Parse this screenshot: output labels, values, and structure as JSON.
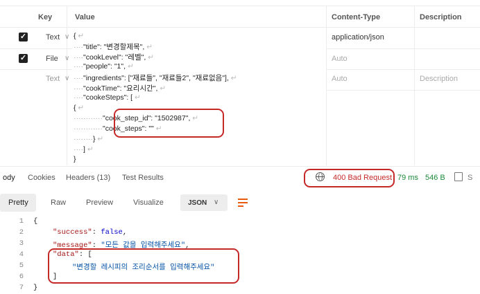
{
  "params_table": {
    "headers": {
      "key": "Key",
      "value": "Value",
      "content_type": "Content-Type",
      "description": "Description"
    },
    "rows": [
      {
        "type": "Text",
        "content_type": "application/json",
        "description": ""
      },
      {
        "type": "File",
        "content_type": "Auto",
        "description": ""
      },
      {
        "type": "Text",
        "content_type": "Auto",
        "description": "Description"
      }
    ],
    "value_lines": [
      "{",
      "\"title\": \"변경할제목\",",
      "\"cookLevel\": \"레벨\",",
      "\"people\": \"1\",",
      "\"ingredients\": [\"재료들\", \"재료들2\", \"재료없음\"],",
      "\"cookTime\": \"요리시간\",",
      "\"cookeSteps\": [",
      "{",
      "\"cook_step_id\": \"1502987\",",
      "\"cook_steps\": \"\"",
      "}",
      "]",
      "}"
    ]
  },
  "response_tabs": {
    "body": "ody",
    "cookies": "Cookies",
    "headers": "Headers (13)",
    "test_results": "Test Results"
  },
  "status": {
    "code": "400 Bad Request",
    "time": "79 ms",
    "size": "546 B",
    "extra": "S"
  },
  "view_tabs": {
    "pretty": "Pretty",
    "raw": "Raw",
    "preview": "Preview",
    "visualize": "Visualize",
    "format": "JSON"
  },
  "response_lines": {
    "numbers": [
      "1",
      "2",
      "3",
      "4",
      "5",
      "6",
      "7"
    ],
    "l1": "{",
    "success_key": "\"success\"",
    "success_val": "false",
    "message_key": "\"message\"",
    "message_val": "\"모든 값을 입력해주세요\"",
    "data_key": "\"data\"",
    "data_open": "[",
    "data_item": "\"변경할 레시피의 조리순서를 입력해주세요\"",
    "data_close": "]",
    "l7": "}"
  },
  "colors": {
    "accent_red": "#c62828",
    "success_green": "#1b8a3a",
    "orange": "#e8590c"
  },
  "icons": [
    "checkbox-checked-icon",
    "chevron-down-icon",
    "globe-icon",
    "save-icon",
    "wrap-lines-icon"
  ]
}
